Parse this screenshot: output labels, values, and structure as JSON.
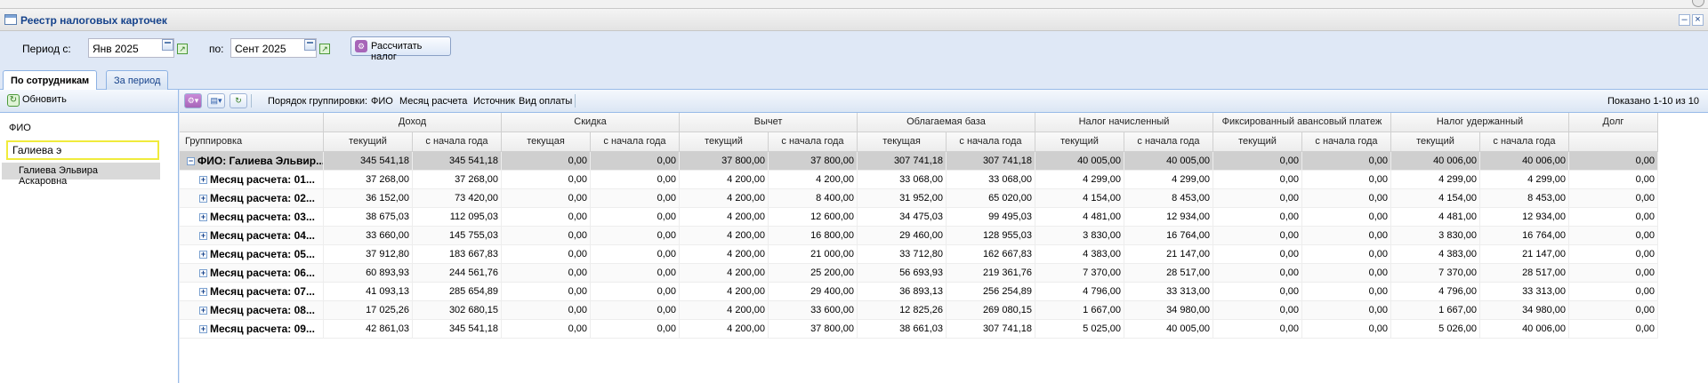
{
  "window": {
    "title": "Реестр налоговых карточек"
  },
  "toolbar": {
    "period_from_label": "Период с:",
    "period_from_value": "Янв 2025",
    "period_to_label": "по:",
    "period_to_value": "Сент 2025",
    "calc_button": "Рассчитать налог"
  },
  "tabs": [
    {
      "label": "По сотрудникам",
      "active": true
    },
    {
      "label": "За период",
      "active": false
    }
  ],
  "left_panel": {
    "refresh_label": "Обновить",
    "column_header": "ФИО",
    "search_value": "Галиева э",
    "employees": [
      "Галиева Эльвира Аскаровна"
    ]
  },
  "grid_toolbar": {
    "grouping_label": "Порядок группировки:",
    "groupings": [
      "ФИО",
      "Месяц расчета",
      "Источник",
      "Вид оплаты"
    ],
    "shown_text": "Показано 1-10 из 10"
  },
  "grid": {
    "group_header": "Группировка",
    "column_groups": [
      "Доход",
      "Скидка",
      "Вычет",
      "Облагаемая база",
      "Налог начисленный",
      "Фиксированный авансовый платеж",
      "Налог удержанный",
      "Долг"
    ],
    "sub_current": "текущий",
    "sub_current_f": "текущая",
    "sub_ytd": "с начала года",
    "rows": [
      {
        "name": "ФИО: Галиева Эльвир...",
        "total": true,
        "values": [
          "345 541,18",
          "345 541,18",
          "0,00",
          "0,00",
          "37 800,00",
          "37 800,00",
          "307 741,18",
          "307 741,18",
          "40 005,00",
          "40 005,00",
          "0,00",
          "0,00",
          "40 006,00",
          "40 006,00",
          "0,00"
        ]
      },
      {
        "name": "Месяц расчета: 01...",
        "values": [
          "37 268,00",
          "37 268,00",
          "0,00",
          "0,00",
          "4 200,00",
          "4 200,00",
          "33 068,00",
          "33 068,00",
          "4 299,00",
          "4 299,00",
          "0,00",
          "0,00",
          "4 299,00",
          "4 299,00",
          "0,00"
        ]
      },
      {
        "name": "Месяц расчета: 02...",
        "values": [
          "36 152,00",
          "73 420,00",
          "0,00",
          "0,00",
          "4 200,00",
          "8 400,00",
          "31 952,00",
          "65 020,00",
          "4 154,00",
          "8 453,00",
          "0,00",
          "0,00",
          "4 154,00",
          "8 453,00",
          "0,00"
        ]
      },
      {
        "name": "Месяц расчета: 03...",
        "values": [
          "38 675,03",
          "112 095,03",
          "0,00",
          "0,00",
          "4 200,00",
          "12 600,00",
          "34 475,03",
          "99 495,03",
          "4 481,00",
          "12 934,00",
          "0,00",
          "0,00",
          "4 481,00",
          "12 934,00",
          "0,00"
        ]
      },
      {
        "name": "Месяц расчета: 04...",
        "values": [
          "33 660,00",
          "145 755,03",
          "0,00",
          "0,00",
          "4 200,00",
          "16 800,00",
          "29 460,00",
          "128 955,03",
          "3 830,00",
          "16 764,00",
          "0,00",
          "0,00",
          "3 830,00",
          "16 764,00",
          "0,00"
        ]
      },
      {
        "name": "Месяц расчета: 05...",
        "values": [
          "37 912,80",
          "183 667,83",
          "0,00",
          "0,00",
          "4 200,00",
          "21 000,00",
          "33 712,80",
          "162 667,83",
          "4 383,00",
          "21 147,00",
          "0,00",
          "0,00",
          "4 383,00",
          "21 147,00",
          "0,00"
        ]
      },
      {
        "name": "Месяц расчета: 06...",
        "values": [
          "60 893,93",
          "244 561,76",
          "0,00",
          "0,00",
          "4 200,00",
          "25 200,00",
          "56 693,93",
          "219 361,76",
          "7 370,00",
          "28 517,00",
          "0,00",
          "0,00",
          "7 370,00",
          "28 517,00",
          "0,00"
        ]
      },
      {
        "name": "Месяц расчета: 07...",
        "values": [
          "41 093,13",
          "285 654,89",
          "0,00",
          "0,00",
          "4 200,00",
          "29 400,00",
          "36 893,13",
          "256 254,89",
          "4 796,00",
          "33 313,00",
          "0,00",
          "0,00",
          "4 796,00",
          "33 313,00",
          "0,00"
        ]
      },
      {
        "name": "Месяц расчета: 08...",
        "values": [
          "17 025,26",
          "302 680,15",
          "0,00",
          "0,00",
          "4 200,00",
          "33 600,00",
          "12 825,26",
          "269 080,15",
          "1 667,00",
          "34 980,00",
          "0,00",
          "0,00",
          "1 667,00",
          "34 980,00",
          "0,00"
        ]
      },
      {
        "name": "Месяц расчета: 09...",
        "values": [
          "42 861,03",
          "345 541,18",
          "0,00",
          "0,00",
          "4 200,00",
          "37 800,00",
          "38 661,03",
          "307 741,18",
          "5 025,00",
          "40 005,00",
          "0,00",
          "0,00",
          "5 026,00",
          "40 006,00",
          "0,00"
        ]
      }
    ]
  },
  "icons": {
    "window": "window-icon",
    "calendar": "calendar-icon",
    "calc": "calculator-icon",
    "refresh": "refresh-icon",
    "expand": "expand-plus-icon",
    "collapse": "collapse-minus-icon"
  }
}
